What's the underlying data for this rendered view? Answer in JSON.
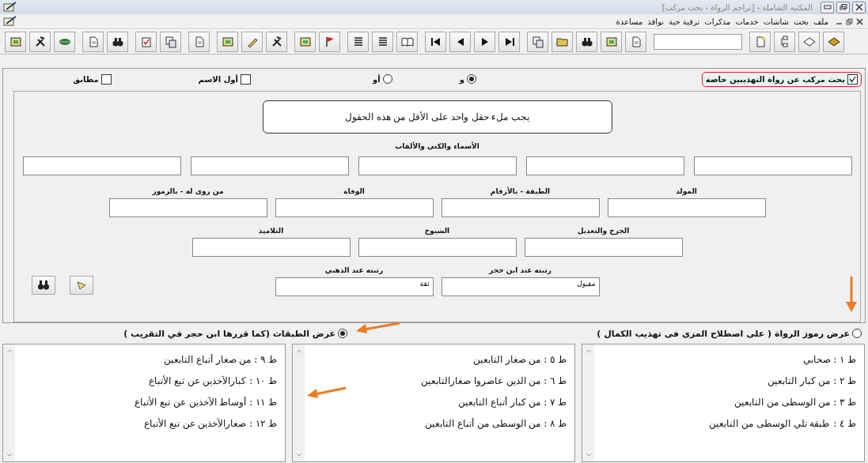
{
  "window": {
    "title": "المكتبة الشاملة - [تراجم الرواة - بحث مركب]"
  },
  "menu": [
    "ملف",
    "بحث",
    "شاشات",
    "خدمات",
    "مذكرات",
    "ترقية حية",
    "نوافذ",
    "مساعدة"
  ],
  "options": {
    "special_search": {
      "label": "بحث مركب عن رواة التهذيبين خاصة",
      "checked": true
    },
    "logic": [
      {
        "label": "و",
        "selected": true
      },
      {
        "label": "أو",
        "selected": false
      }
    ],
    "flags": [
      {
        "label": "أول الاسم",
        "checked": false
      },
      {
        "label": "مطابق",
        "checked": false
      }
    ]
  },
  "notice": "يجب ملء حقل واحد على الأقل من هذه الحقول",
  "names": {
    "label": "الأسماء والكنى والألقاب"
  },
  "field_rows": [
    [
      {
        "label": "المولد"
      },
      {
        "label": "الطبقة - بالأرقام"
      },
      {
        "label": "الوفاة"
      },
      {
        "label": "من روى له - بالرموز"
      }
    ],
    [
      {
        "label": "الجرح والتعديل"
      },
      {
        "label": "الشيوخ"
      },
      {
        "label": "التلاميذ"
      }
    ],
    [
      {
        "label": "رتبته عند ابن حجر",
        "value": "مقبول"
      },
      {
        "label": "رتبته عند الذهبي",
        "value": "ثقة"
      }
    ]
  ],
  "display": [
    {
      "label": "عرض رموز الرواة ( على اصطلاح المزى فى تهذيب الكمال )",
      "selected": false
    },
    {
      "label": "عرض الطبقات (كما قررها ابن حجر في التقريب )",
      "selected": true
    }
  ],
  "lists": [
    [
      "ط ١ : صحابي",
      "ط ٢ : من كبار التابعين",
      "ط ٣ : من الوسطى من التابعين",
      "ط ٤ : طبقة تلي الوسطى من التابعين"
    ],
    [
      "ط ٥ : من صغار التابعين",
      "ط ٦ : من الذين عاصروا صغارالتابعين",
      "ط ٧ : من كبار أتباع التابعين",
      "ط ٨ : من الوسطى من أتباع التابعين"
    ],
    [
      "ط ٩ : من صغار أتباع التابعين",
      "ط ١٠ : كبارالآخذين عن تبع الأتباع",
      "ط ١١ : أوساط الآخذين عن تبع الأتباع",
      "ط ١٢ : صغارالآخذين عن تبع الأتباع"
    ]
  ]
}
